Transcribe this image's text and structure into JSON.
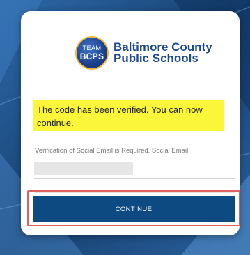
{
  "logo": {
    "badge_line1": "TEAM",
    "badge_line2": "BCPS",
    "brand_line1": "Baltimore County",
    "brand_line2": "Public Schools"
  },
  "message": {
    "verified": "The code has been verified. You can now continue."
  },
  "verification": {
    "label": "Verification of Social Email is Required. Social Email:"
  },
  "actions": {
    "continue_label": "CONTINUE"
  },
  "colors": {
    "background": "#1f4e86",
    "primary_button": "#0e4a82",
    "highlight": "#fbf63a",
    "brand": "#1d4b91",
    "focus_ring": "#e06060"
  }
}
